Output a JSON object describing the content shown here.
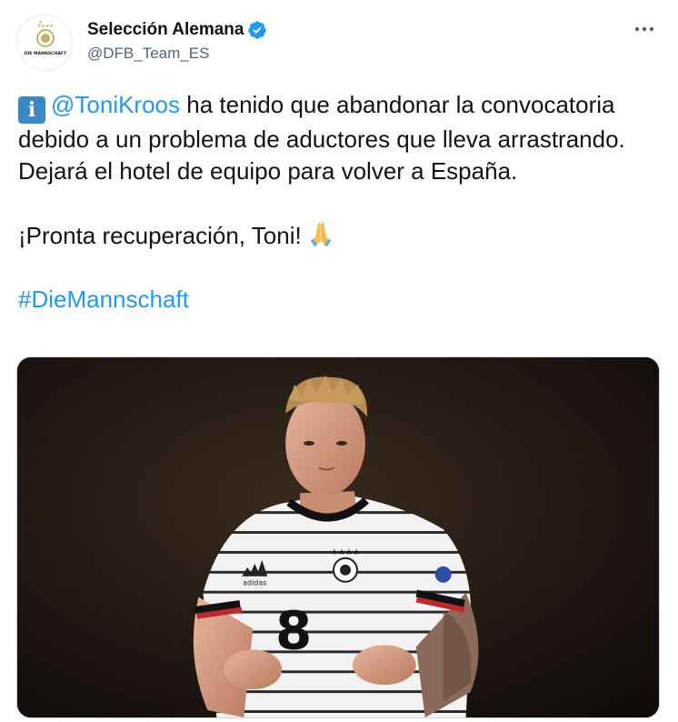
{
  "author": {
    "display_name": "Selección Alemana",
    "handle": "@DFB_Team_ES",
    "avatar_caption": "DIE MANNSCHAFT",
    "verified": true
  },
  "tweet": {
    "mention": "@ToniKroos",
    "text_after_mention": " ha tenido que abandonar la convocatoria debido a un problema de aductores que lleva arrastrando. Dejará el hotel de equipo para volver a España.",
    "line2": "¡Pronta recuperación, Toni!",
    "hashtag": "#DieMannschaft"
  },
  "media": {
    "jersey_number": "8",
    "description_icon": "photo"
  },
  "icons": {
    "info": "info-icon",
    "pray": "folded-hands-icon",
    "more": "more-horizontal-icon",
    "verified": "verified-badge-icon"
  },
  "colors": {
    "link": "#1d9bf0",
    "verified": "#1d9bf0",
    "text": "#0f1419",
    "secondary": "#536471"
  }
}
